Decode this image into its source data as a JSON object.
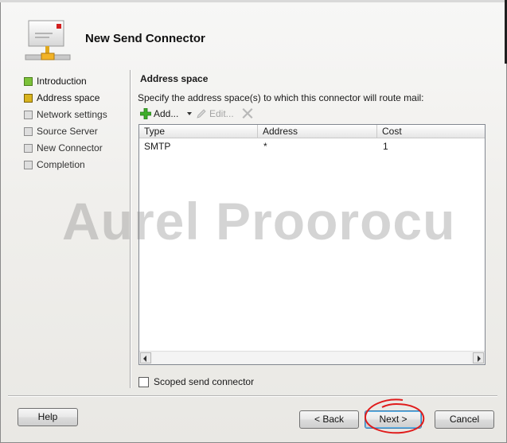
{
  "window": {
    "title": "New Send Connector"
  },
  "nav": {
    "items": [
      {
        "label": "Introduction",
        "state": "completed",
        "color": "#7cc23a"
      },
      {
        "label": "Address space",
        "state": "current",
        "color": "#d9b41f"
      },
      {
        "label": "Network settings",
        "state": "pending"
      },
      {
        "label": "Source Server",
        "state": "pending"
      },
      {
        "label": "New Connector",
        "state": "pending"
      },
      {
        "label": "Completion",
        "state": "pending"
      }
    ]
  },
  "page": {
    "section_title": "Address space",
    "instruction": "Specify the address space(s) to which this connector will route mail:"
  },
  "toolbar": {
    "add_label": "Add...",
    "add_icon": "plus-icon",
    "edit_label": "Edit...",
    "edit_icon": "pencil-icon",
    "remove_icon": "x-icon"
  },
  "table": {
    "columns": [
      "Type",
      "Address",
      "Cost"
    ],
    "rows": [
      {
        "type": "SMTP",
        "address": "*",
        "cost": "1"
      }
    ]
  },
  "watermark": "Aurel Proorocu",
  "options": {
    "scoped_label": "Scoped send connector",
    "scoped_checked": false
  },
  "buttons": {
    "help": "Help",
    "back": "< Back",
    "next": "Next >",
    "cancel": "Cancel"
  },
  "colors": {
    "annotation": "#e01b1b"
  }
}
